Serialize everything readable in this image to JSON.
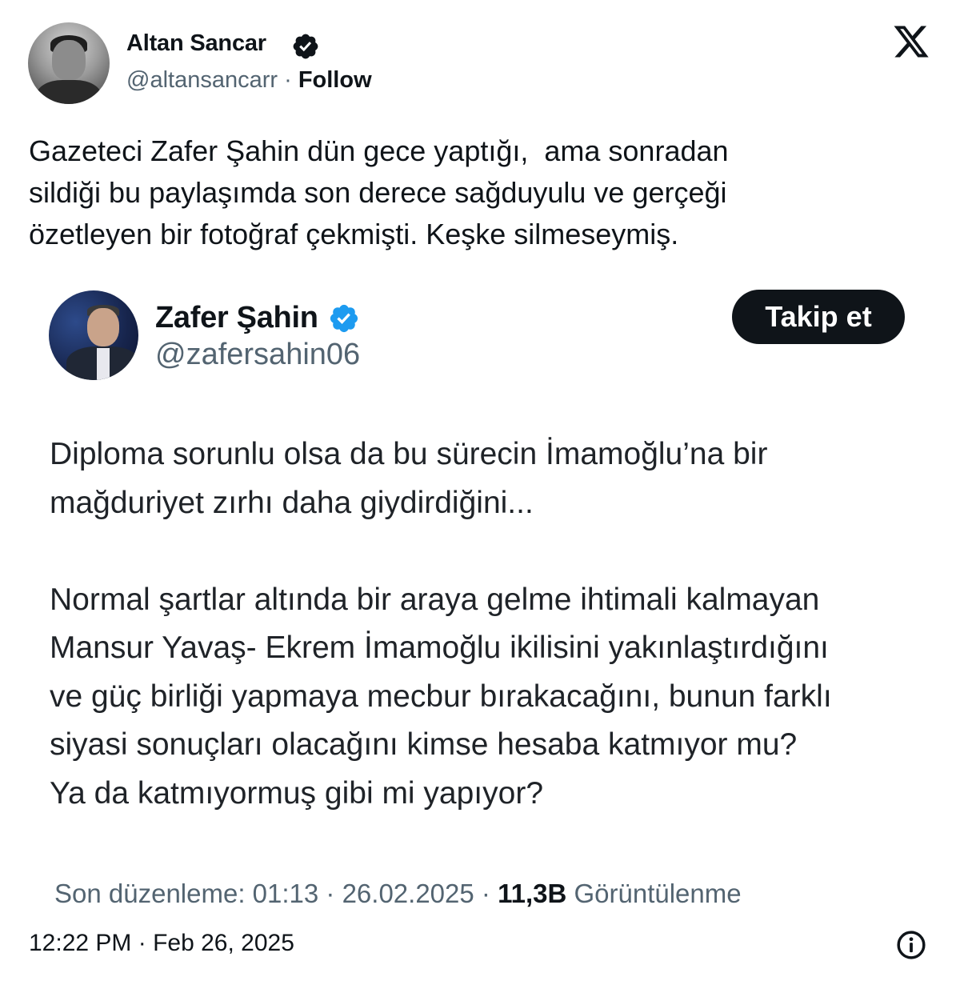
{
  "author": {
    "name": "Altan Sancar",
    "handle": "@altansancarr",
    "separator": " · ",
    "follow_label": "Follow"
  },
  "tweet": {
    "text": "Gazeteci Zafer Şahin dün gece yaptığı,  ama sonradan\nsildiği bu paylaşımda son derece sağduyulu ve gerçeği\nözetleyen bir fotoğraf çekmişti. Keşke silmeseymiş."
  },
  "embedded_post": {
    "name": "Zafer Şahin",
    "handle": "@zafersahin06",
    "follow_label": "Takip et",
    "text": "Diploma sorunlu olsa da bu sürecin İmamoğlu’na bir\nmağduriyet zırhı daha giydirdiğini...\n\nNormal şartlar altında bir araya gelme ihtimali kalmayan\nMansur Yavaş- Ekrem İmamoğlu ikilisini yakınlaştırdığını\nve güç birliği yapmaya mecbur bırakacağını, bunun farklı\nsiyasi sonuçları olacağını kimse hesaba katmıyor mu?\nYa da katmıyormuş gibi mi yapıyor?",
    "edited_label": "Son düzenleme: 01:13 · 26.02.2025",
    "views_separator": " · ",
    "views_count": "11,3B",
    "views_label": " Görüntülenme"
  },
  "footer": {
    "timestamp": "12:22 PM · Feb 26, 2025"
  },
  "icons": {
    "verified": "verified-badge-icon",
    "x_logo": "x-logo-icon",
    "info": "info-icon"
  },
  "colors": {
    "text": "#0f1419",
    "secondary": "#536471",
    "verified_outer": "#0f1419",
    "verified_inner": "#1d9bf0",
    "button_bg": "#0f1419"
  }
}
